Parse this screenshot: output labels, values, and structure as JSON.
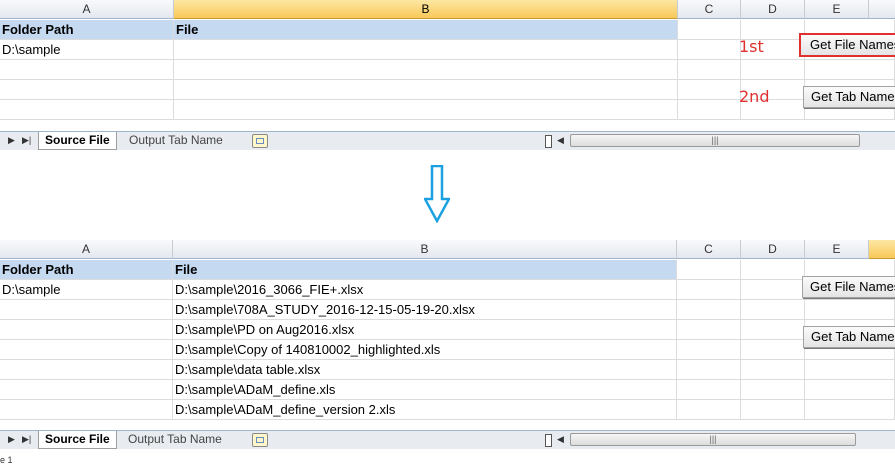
{
  "columns": [
    "A",
    "B",
    "C",
    "D",
    "E"
  ],
  "top_sheet": {
    "header_row": {
      "a": "Folder Path",
      "b": "File"
    },
    "folder_path": "D:\\sample",
    "labels": {
      "first": "1st",
      "second": "2nd"
    },
    "buttons": {
      "get_file_names": "Get File Names",
      "get_tab_names": "Get Tab Names"
    },
    "highlighted_button": "get_file_names",
    "selected_column": "B"
  },
  "bottom_sheet": {
    "header_row": {
      "a": "Folder Path",
      "b": "File"
    },
    "folder_path": "D:\\sample",
    "files": [
      "D:\\sample\\2016_3066_FIE+.xlsx",
      "D:\\sample\\708A_STUDY_2016-12-15-05-19-20.xlsx",
      "D:\\sample\\PD on Aug2016.xlsx",
      "D:\\sample\\Copy of 140810002_highlighted.xls",
      "D:\\sample\\data table.xlsx",
      "D:\\sample\\ADaM_define.xls",
      "D:\\sample\\ADaM_define_version 2.xls"
    ],
    "buttons": {
      "get_file_names": "Get File Names",
      "get_tab_names": "Get Tab Names"
    },
    "selected_column": "F"
  },
  "tabs": [
    {
      "label": "Source File",
      "active": true
    },
    {
      "label": "Output Tab Name",
      "active": false
    }
  ],
  "icons": {
    "arrow": "arrow-down-icon",
    "tab_first": "tab-scroll-first-icon",
    "tab_last": "tab-scroll-last-icon",
    "new_sheet": "insert-worksheet-icon",
    "scroll_left": "scroll-left-icon",
    "grip": "scrollbar-grip-icon"
  },
  "colors": {
    "header_fill": "#c5d9f1",
    "annotation_red": "#e03030",
    "arrow_blue": "#1ba1e2"
  },
  "status_text": "e 1"
}
